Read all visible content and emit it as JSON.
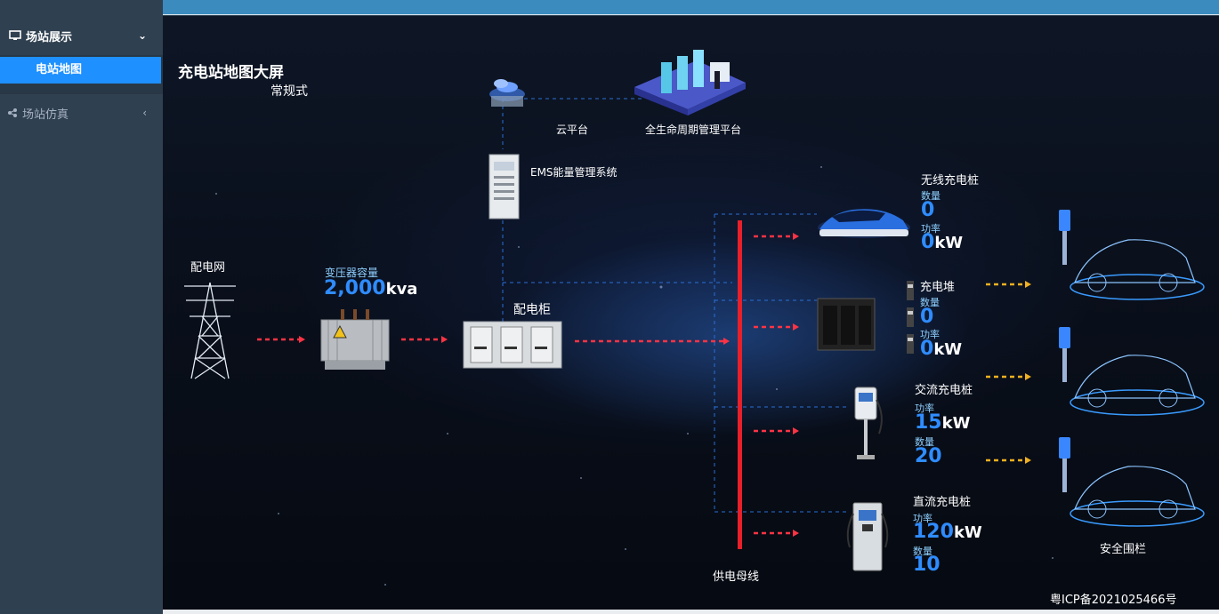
{
  "sidebar": {
    "group1_label": "场站展示",
    "group1_sub_active": "电站地图",
    "group2_label": "场站仿真"
  },
  "stage": {
    "title": "充电站地图大屏",
    "mode": "常规式",
    "cloud_label": "云平台",
    "lifecycle_label": "全生命周期管理平台",
    "ems_label": "EMS能量管理系统",
    "grid_label": "配电网",
    "transformer_label": "变压器容量",
    "transformer_value": "2,000",
    "transformer_unit": "kva",
    "cabinet_label": "配电柜",
    "bus_label": "供电母线",
    "fence_label": "安全围栏",
    "icp": "粤ICP备2021025466号"
  },
  "wireless": {
    "title": "无线充电桩",
    "count_label": "数量",
    "count": "0",
    "power_label": "功率",
    "power": "0",
    "power_unit": "kW"
  },
  "pile": {
    "title": "充电堆",
    "count_label": "数量",
    "count": "0",
    "power_label": "功率",
    "power": "0",
    "power_unit": "kW"
  },
  "ac": {
    "title": "交流充电桩",
    "power_label": "功率",
    "power": "15",
    "power_unit": "kW",
    "count_label": "数量",
    "count": "20"
  },
  "dc": {
    "title": "直流充电桩",
    "power_label": "功率",
    "power": "120",
    "power_unit": "kW",
    "count_label": "数量",
    "count": "10"
  },
  "colors": {
    "accent": "#1e90ff",
    "bus": "#e8202a",
    "arrow_red": "#ff3344",
    "arrow_yellow": "#f0b020",
    "dash": "#2a6fd6"
  }
}
